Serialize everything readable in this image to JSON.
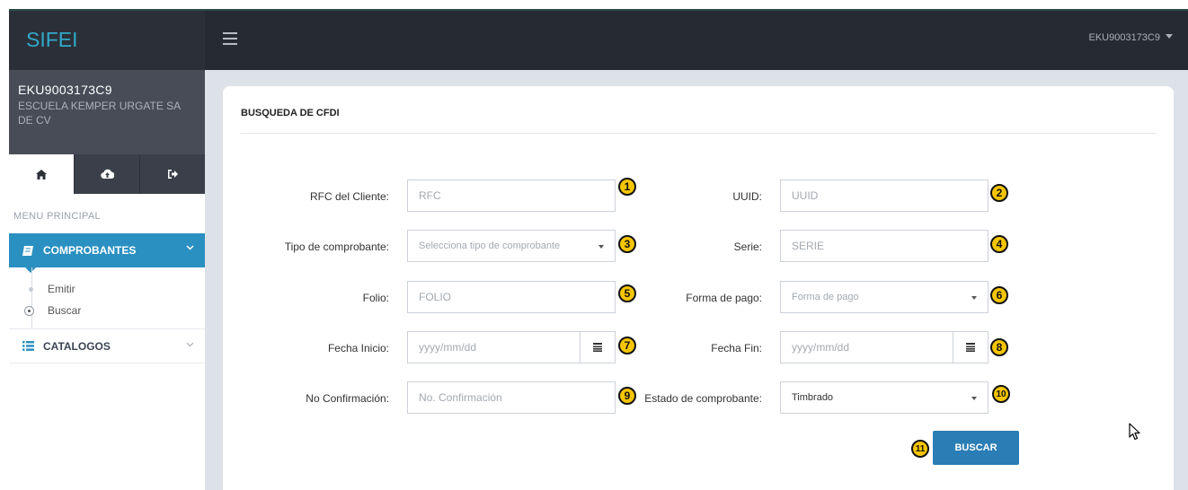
{
  "brand": "SIFEI",
  "topbar": {
    "user": "EKU9003173C9"
  },
  "profile": {
    "rfc": "EKU9003173C9",
    "name": "ESCUELA KEMPER URGATE SA DE CV"
  },
  "sidebar": {
    "tabs": [
      {
        "icon": "home-icon"
      },
      {
        "icon": "cloud-upload-icon"
      },
      {
        "icon": "logout-icon"
      }
    ],
    "menu_title": "MENU PRINCIPAL",
    "sections": [
      {
        "label": "COMPROBANTES",
        "icon": "book-icon",
        "expanded": true,
        "items": [
          {
            "label": "Emitir"
          },
          {
            "label": "Buscar",
            "active": true
          }
        ]
      },
      {
        "label": "CATALOGOS",
        "icon": "list-icon",
        "expanded": false
      }
    ]
  },
  "panel": {
    "title": "BUSQUEDA DE CFDI",
    "fields": {
      "rfc": {
        "label": "RFC del Cliente:",
        "placeholder": "RFC",
        "badge": "1"
      },
      "uuid": {
        "label": "UUID:",
        "placeholder": "UUID",
        "badge": "2"
      },
      "tipo": {
        "label": "Tipo de comprobante:",
        "placeholder": "Selecciona tipo de comprobante",
        "badge": "3"
      },
      "serie": {
        "label": "Serie:",
        "placeholder": "SERIE",
        "badge": "4"
      },
      "folio": {
        "label": "Folio:",
        "placeholder": "FOLIO",
        "badge": "5"
      },
      "forma": {
        "label": "Forma de pago:",
        "placeholder": "Forma de pago",
        "badge": "6"
      },
      "fecha_inicio": {
        "label": "Fecha Inicio:",
        "placeholder": "yyyy/mm/dd",
        "badge": "7"
      },
      "fecha_fin": {
        "label": "Fecha Fin:",
        "placeholder": "yyyy/mm/dd",
        "badge": "8"
      },
      "no_conf": {
        "label": "No Confirmación:",
        "placeholder": "No. Confirmación",
        "badge": "9"
      },
      "estado": {
        "label": "Estado de comprobante:",
        "value": "Timbrado",
        "badge": "10"
      }
    },
    "button": {
      "label": "BUSCAR",
      "badge": "11"
    }
  },
  "colors": {
    "accent": "#2a90c1",
    "button": "#2a7db5",
    "badge": "#f5c500",
    "topbar": "#262b33",
    "brand_text": "#31a9c9"
  }
}
